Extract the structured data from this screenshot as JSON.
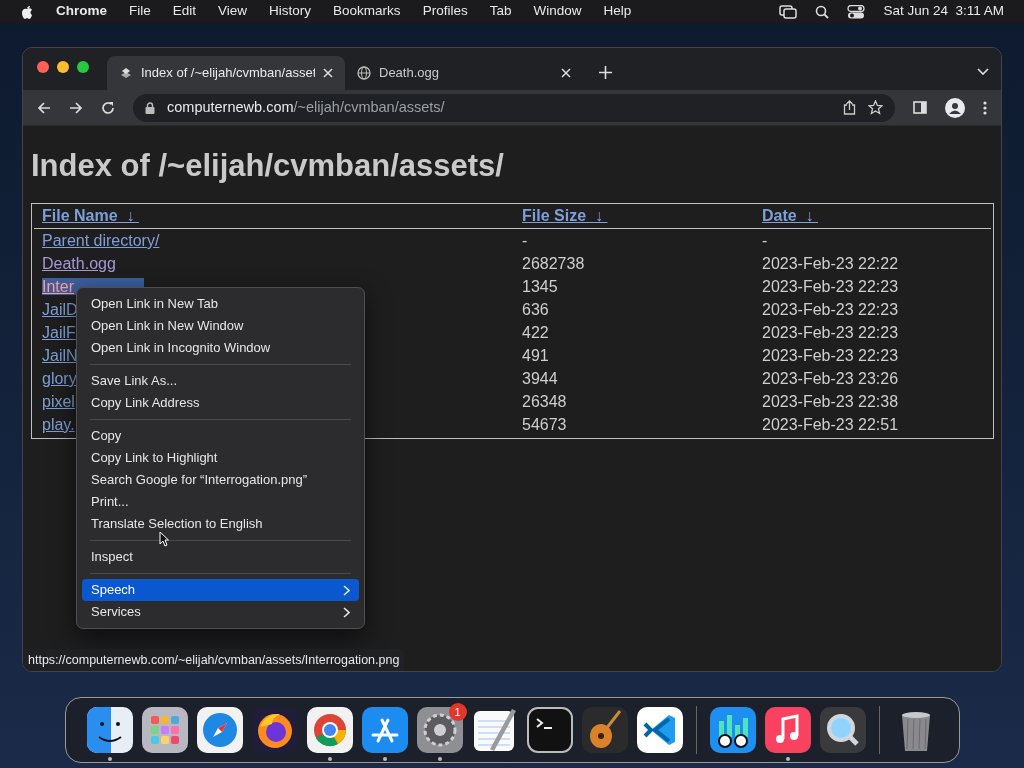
{
  "menu_bar": {
    "app": "Chrome",
    "items": [
      "File",
      "Edit",
      "View",
      "History",
      "Bookmarks",
      "Profiles",
      "Tab",
      "Window",
      "Help"
    ],
    "clock": "Sat Jun 24  3:11 AM"
  },
  "tabs": [
    {
      "title": "Index of /~elijah/cvmban/asset",
      "selected": true
    },
    {
      "title": "Death.ogg",
      "selected": false
    }
  ],
  "address": {
    "host": "computernewb.com",
    "path": "/~elijah/cvmban/assets/"
  },
  "page": {
    "heading": "Index of /~elijah/cvmban/assets/",
    "columns": [
      {
        "label": "File Name",
        "arrow": "↓"
      },
      {
        "label": "File Size",
        "arrow": "↓"
      },
      {
        "label": "Date",
        "arrow": "↓"
      }
    ],
    "rows": [
      {
        "name": "Parent directory/",
        "size": "-",
        "date": "-",
        "visited": false,
        "selected": false
      },
      {
        "name": "Death.ogg",
        "size": "2682738",
        "date": "2023-Feb-23 22:22",
        "visited": true,
        "selected": false
      },
      {
        "name": "Inter",
        "size": "1345",
        "date": "2023-Feb-23 22:23",
        "visited": false,
        "selected": true
      },
      {
        "name": "JailD",
        "size": "636",
        "date": "2023-Feb-23 22:23",
        "visited": false,
        "selected": false
      },
      {
        "name": "JailF",
        "size": "422",
        "date": "2023-Feb-23 22:23",
        "visited": false,
        "selected": false
      },
      {
        "name": "JailN",
        "size": "491",
        "date": "2023-Feb-23 22:23",
        "visited": false,
        "selected": false
      },
      {
        "name": "glory",
        "size": "3944",
        "date": "2023-Feb-23 23:26",
        "visited": false,
        "selected": false
      },
      {
        "name": "pixel",
        "size": "26348",
        "date": "2023-Feb-23 22:38",
        "visited": false,
        "selected": false
      },
      {
        "name": "play.",
        "size": "54673",
        "date": "2023-Feb-23 22:51",
        "visited": false,
        "selected": false
      }
    ]
  },
  "context_menu": [
    {
      "kind": "item",
      "label": "Open Link in New Tab",
      "selected": false
    },
    {
      "kind": "item",
      "label": "Open Link in New Window",
      "selected": false
    },
    {
      "kind": "item",
      "label": "Open Link in Incognito Window",
      "selected": false
    },
    {
      "kind": "separator"
    },
    {
      "kind": "item",
      "label": "Save Link As...",
      "selected": false
    },
    {
      "kind": "item",
      "label": "Copy Link Address",
      "selected": false
    },
    {
      "kind": "separator"
    },
    {
      "kind": "item",
      "label": "Copy",
      "selected": false
    },
    {
      "kind": "item",
      "label": "Copy Link to Highlight",
      "selected": false
    },
    {
      "kind": "item",
      "label": "Search Google for “Interrogation.png”",
      "selected": false
    },
    {
      "kind": "item",
      "label": "Print...",
      "selected": false
    },
    {
      "kind": "item",
      "label": "Translate Selection to English",
      "selected": false
    },
    {
      "kind": "separator"
    },
    {
      "kind": "item",
      "label": "Inspect",
      "selected": false
    },
    {
      "kind": "separator"
    },
    {
      "kind": "submenu",
      "label": "Speech",
      "selected": true
    },
    {
      "kind": "submenu",
      "label": "Services",
      "selected": false
    }
  ],
  "status_url": "https://computernewb.com/~elijah/cvmban/assets/Interrogation.png",
  "dock": [
    {
      "kind": "app",
      "running": true
    },
    {
      "kind": "app",
      "running": false
    },
    {
      "kind": "app",
      "running": false
    },
    {
      "kind": "app",
      "running": false
    },
    {
      "kind": "app",
      "running": true
    },
    {
      "kind": "app",
      "running": true
    },
    {
      "kind": "app",
      "running": true,
      "badge": "1"
    },
    {
      "kind": "app",
      "running": false
    },
    {
      "kind": "app",
      "running": false
    },
    {
      "kind": "app",
      "running": false
    },
    {
      "kind": "app",
      "running": false
    },
    {
      "kind": "divider"
    },
    {
      "kind": "app",
      "running": false
    },
    {
      "kind": "app",
      "running": true
    },
    {
      "kind": "app",
      "running": false
    },
    {
      "kind": "divider"
    },
    {
      "kind": "app",
      "running": false
    }
  ]
}
